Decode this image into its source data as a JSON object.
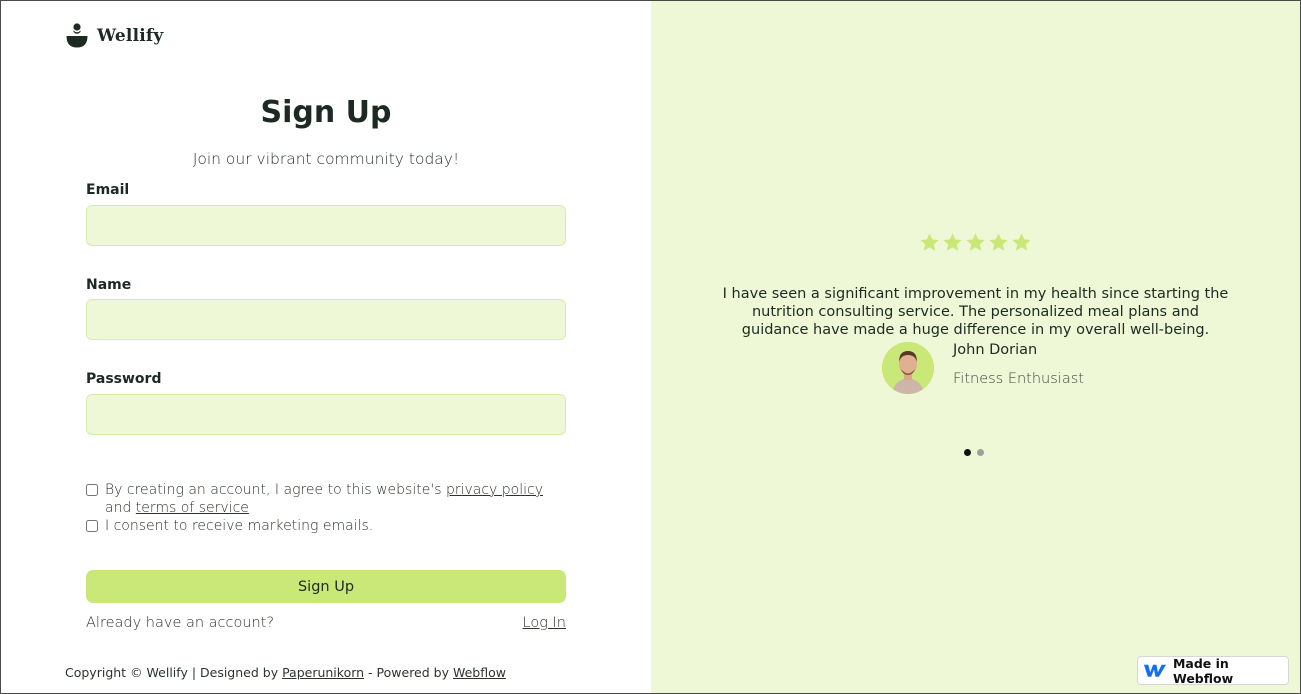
{
  "brand": {
    "name": "Wellify",
    "icon": "wellify-logo-icon"
  },
  "form": {
    "title": "Sign Up",
    "subtitle": "Join our vibrant community today!",
    "email_label": "Email",
    "email_value": "",
    "name_label": "Name",
    "name_value": "",
    "password_label": "Password",
    "password_value": "",
    "terms_text_before": "By creating an account, I agree to this website's ",
    "terms_privacy_link": "privacy policy",
    "terms_text_middle": " and ",
    "terms_tos_link": "terms of service",
    "terms_checked": false,
    "marketing_text": "I consent to receive marketing emails.",
    "marketing_checked": false,
    "submit_label": "Sign Up",
    "account_prompt": "Already have an account?",
    "login_link": "Log In"
  },
  "footer": {
    "prefix": "Copyright © Wellify | Designed by ",
    "designer_link": "Paperunikorn",
    "middle": " - Powered by ",
    "powered_link": "Webflow"
  },
  "testimonial": {
    "rating": 5,
    "quote": "I have seen a significant improvement in my health since starting the nutrition consulting service. The personalized meal plans and guidance have made a huge difference in my overall well-being.",
    "author_name": "John Dorian",
    "author_role": "Fitness Enthusiast",
    "slide_count": 2,
    "active_slide": 1
  },
  "badge": {
    "label": "Made in Webflow",
    "icon": "webflow-logo-icon"
  },
  "colors": {
    "accent": "#c9e877",
    "panel_bg": "#eef8d6",
    "input_bg": "#eef8d6",
    "text_dark": "#1d2a22"
  }
}
